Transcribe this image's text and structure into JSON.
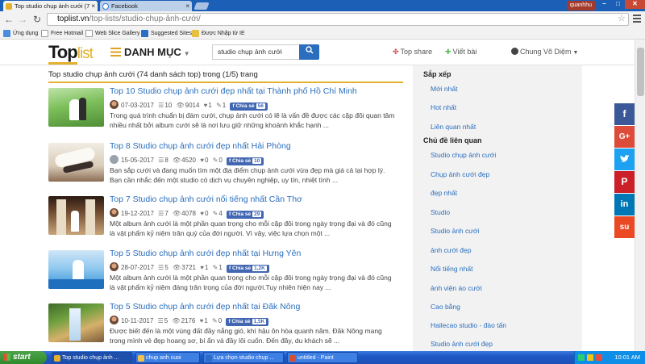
{
  "browser": {
    "tabs": [
      {
        "label": "Top studio chụp ảnh cưới (7",
        "active": true,
        "favicon_color": "#e4b12f"
      },
      {
        "label": "Facebook",
        "active": false,
        "favicon_color": "#ffffff"
      }
    ],
    "user_badge": "quanhhu",
    "window_controls": [
      "–",
      "□",
      "✕"
    ],
    "nav": {
      "back": "←",
      "forward": "→",
      "reload": "↻"
    },
    "url_domain": "toplist.vn",
    "url_path": "/top-lists/studio-chụp-ảnh-cưới/",
    "bookmarks": [
      {
        "label": "Ứng dụng",
        "icon_color": "#4a8de0"
      },
      {
        "label": "Free Hotmail",
        "icon_color": "#2b6cc4"
      },
      {
        "label": "Web Slice Gallery",
        "icon_color": "#3d7fd6"
      },
      {
        "label": "Suggested Sites",
        "icon_color": "#2b6cc4"
      },
      {
        "label": "Được Nhập từ IE",
        "icon_color": "#e8c040"
      }
    ]
  },
  "site": {
    "logo_top": "Top",
    "logo_list": "list",
    "category_label": "DANH MỤC",
    "search_value": "studio chụp ảnh cưới",
    "search_icon": "🔍",
    "top_share": "Top share",
    "write_post": "Viết bài",
    "user_name": "Chung Võ Diệm",
    "accent": "#e4b12f",
    "link_color": "#2a6ebd"
  },
  "main": {
    "heading": "Top studio chụp ảnh cưới (74 danh sách top) trong (1/5) trang",
    "items": [
      {
        "number": "Top 10",
        "title": "Studio chụp ảnh cưới đẹp nhất tại Thành phố Hồ Chí Minh",
        "date": "07-03-2017",
        "list_count": "10",
        "views": "9014",
        "likes": "1",
        "comments": "1",
        "share_label": "Chia sẻ",
        "share_count": "56",
        "desc": "Trong quá trình chuẩn bị đám cưới, chụp ảnh cưới có lẽ là vấn đề được các cặp đôi quan tâm nhiều nhất bởi album cưới sẽ là nơi lưu giữ những khoảnh khắc hạnh ..."
      },
      {
        "number": "Top 8",
        "title": "Studio chụp ảnh cưới đẹp nhất Hải Phòng",
        "date": "15-05-2017",
        "list_count": "8",
        "views": "4520",
        "likes": "0",
        "comments": "0",
        "share_label": "Chia sẻ",
        "share_count": "10",
        "desc": "Bạn sắp cưới và đang muốn tìm một địa điểm chụp ảnh cưới vừa đẹp mà giá cả lại hợp lý. Bạn cần nhắc đến một studio có dịch vụ chuyên nghiệp, uy tín, nhiệt tình ..."
      },
      {
        "number": "Top 7",
        "title": "Studio chụp ảnh cưới nổi tiếng nhất Cần Thơ",
        "date": "19-12-2017",
        "list_count": "7",
        "views": "4078",
        "likes": "0",
        "comments": "4",
        "share_label": "Chia sẻ",
        "share_count": "29",
        "desc": "Một album ảnh cưới là một phần quan trọng cho mỗi cặp đôi trong ngày trọng đại và đó cũng là vật phẩm kỷ niệm trân quý của đời người. Vì vậy, việc lựa chọn một ..."
      },
      {
        "number": "Top 5",
        "title": "Studio chụp ảnh cưới đẹp nhất tại Hưng Yên",
        "date": "28-07-2017",
        "list_count": "5",
        "views": "3721",
        "likes": "1",
        "comments": "1",
        "share_label": "Chia sẻ",
        "share_count": "1,2K",
        "desc": "Một album ảnh cưới là một phần quan trọng cho mỗi cặp đôi trong ngày trọng đại và đó cũng là vật phẩm kỷ niệm đáng trân trọng của đời người.Tuy nhiên hiện nay ..."
      },
      {
        "number": "Top 5",
        "title": "Studio chụp ảnh cưới đẹp nhất tại Đăk Nông",
        "date": "10-11-2017",
        "list_count": "5",
        "views": "2176",
        "likes": "1",
        "comments": "0",
        "share_label": "Chia sẻ",
        "share_count": "1,5K",
        "desc": "Được biết đến là một vùng đất đầy nắng gió, khí hậu ôn hòa quanh năm. Đăk Nông mang trong mình vẻ đẹp hoang sơ, bí ẩn và đầy lôi cuốn. Đến đây, du khách sẽ ..."
      }
    ]
  },
  "sidebar": {
    "sort_heading": "Sắp xếp",
    "sort_items": [
      "Mới nhất",
      "Hot nhất",
      "Liên quan nhất"
    ],
    "topics_heading": "Chủ đề liên quan",
    "topics": [
      "Studio chụp ảnh cưới",
      "Chụp ảnh cưới đẹp",
      "đẹp nhất",
      "Studio",
      "Studio ảnh cưới",
      "ảnh cưới đẹp",
      "Nổi tiếng nhất",
      "ảnh viện áo cưới",
      "Cao bằng",
      "Hailecao studio - đào tấn",
      "Studio ảnh cưới đẹp"
    ]
  },
  "social": [
    {
      "name": "facebook",
      "glyph": "f",
      "color": "#3b5998"
    },
    {
      "name": "google-plus",
      "glyph": "G+",
      "color": "#dd4b39"
    },
    {
      "name": "twitter",
      "glyph": "🐦",
      "color": "#1da1f2"
    },
    {
      "name": "pinterest",
      "glyph": "P",
      "color": "#cb2027"
    },
    {
      "name": "linkedin",
      "glyph": "in",
      "color": "#0077b5"
    },
    {
      "name": "stumbleupon",
      "glyph": "su",
      "color": "#eb4924"
    }
  ],
  "taskbar": {
    "start_label": "start",
    "tasks": [
      {
        "label": "Top studio chụp ảnh ...",
        "active": true,
        "icon_color": "#e4b12f"
      },
      {
        "label": "chup anh cuoi",
        "active": false,
        "icon_color": "#f2c14a"
      },
      {
        "label": "Lựa chọn studio chụp ...",
        "active": false,
        "icon_color": "#2b6cc4"
      },
      {
        "label": "untitled - Paint",
        "active": false,
        "icon_color": "#d94f2b"
      }
    ],
    "clock": "10:01 AM"
  }
}
